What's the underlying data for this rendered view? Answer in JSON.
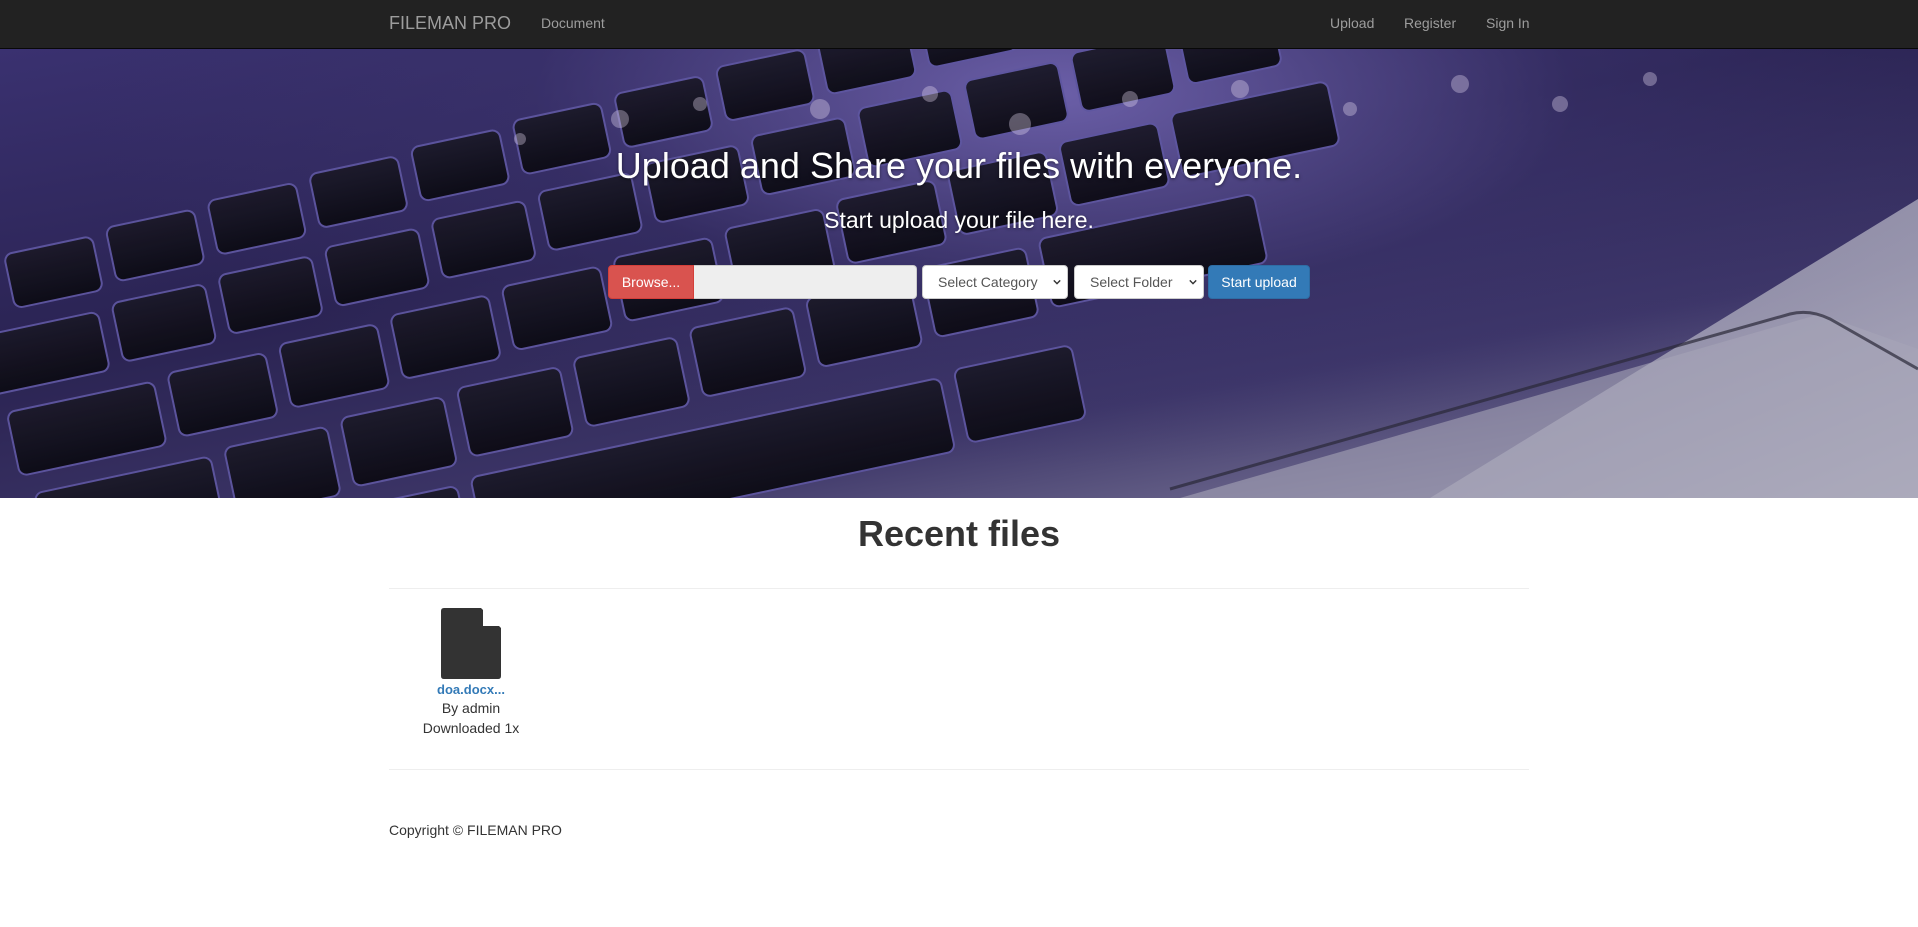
{
  "navbar": {
    "brand": "FILEMAN PRO",
    "links": [
      "Document"
    ],
    "right_links": [
      "Upload",
      "Register",
      "Sign In"
    ]
  },
  "hero": {
    "headline": "Upload and Share your files with everyone.",
    "subline": "Start upload your file here.",
    "browse_label": "Browse...",
    "file_value": "",
    "category_select": "Select Category",
    "folder_select": "Select Folder",
    "start_label": "Start upload"
  },
  "recent": {
    "title": "Recent files",
    "files": [
      {
        "name": "doa.docx...",
        "by": "By admin",
        "downloads": "Downloaded 1x"
      }
    ]
  },
  "footer": {
    "copyright": "Copyright © FILEMAN PRO"
  },
  "colors": {
    "navbar": "#222222",
    "browse": "#d9534f",
    "primary": "#337ab7"
  },
  "icons": [
    "file-icon",
    "chevron-down-icon"
  ]
}
